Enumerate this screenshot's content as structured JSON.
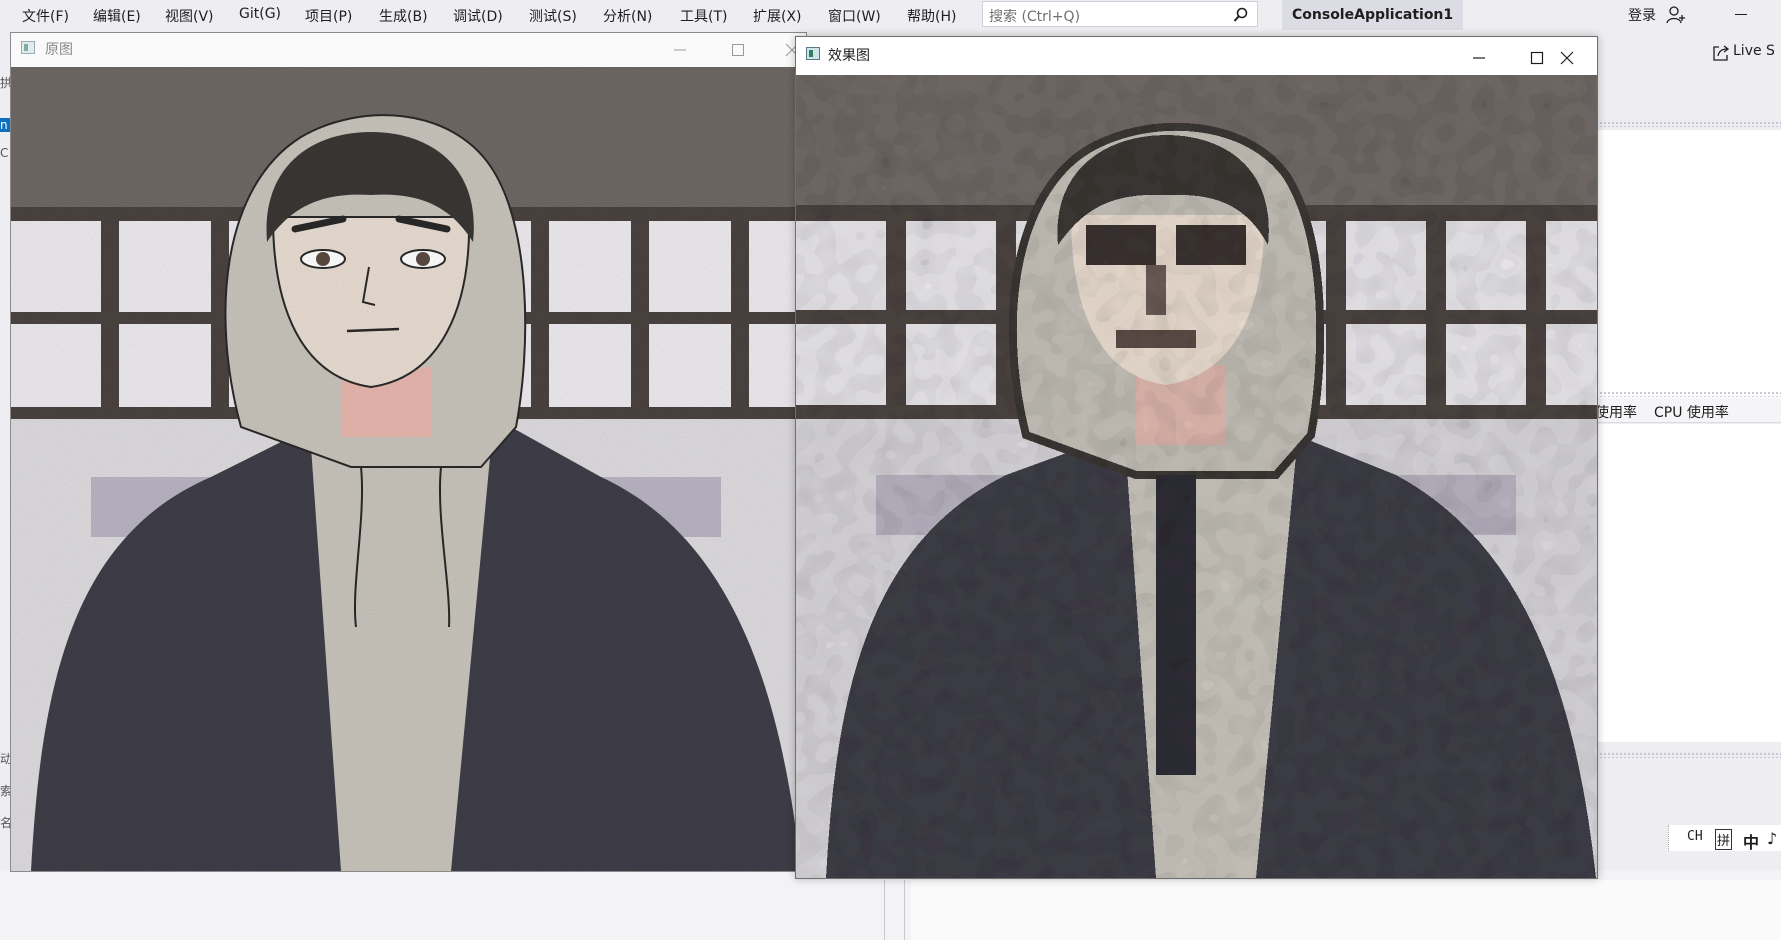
{
  "menubar": {
    "items": [
      "文件(F)",
      "编辑(E)",
      "视图(V)",
      "Git(G)",
      "项目(P)",
      "生成(B)",
      "调试(D)",
      "测试(S)",
      "分析(N)",
      "工具(T)",
      "扩展(X)",
      "窗口(W)",
      "帮助(H)"
    ],
    "search_placeholder": "搜索 (Ctrl+Q)",
    "app_title": "ConsoleApplication1",
    "login_label": "登录"
  },
  "toolbar": {
    "live_share_label": "Live S"
  },
  "diagnostics": {
    "tab_memory": "使用率",
    "tab_cpu": "CPU 使用率"
  },
  "ime": {
    "lang": "CH",
    "mode": "拼",
    "cn": "中"
  },
  "left_fragments": [
    "拱",
    "n",
    "C",
    "动",
    "索",
    "名"
  ],
  "window_original": {
    "title": "原图"
  },
  "window_effect": {
    "title": "效果图"
  },
  "colors": {
    "vs_background": "#eeeef2",
    "title_highlight": "#dcdce4",
    "hoodie_gray": "#c8c4bc",
    "jacket_dark": "#3f3e48",
    "skin": "#e6d8cc"
  }
}
